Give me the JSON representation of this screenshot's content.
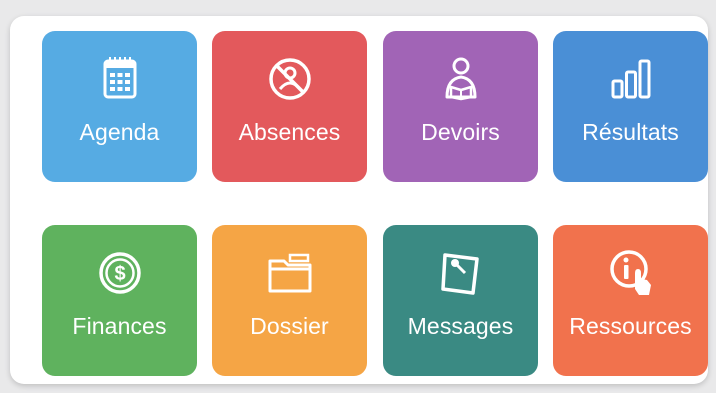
{
  "tiles": [
    {
      "label": "Agenda",
      "icon": "calendar-icon",
      "color": "#56abe3"
    },
    {
      "label": "Absences",
      "icon": "no-person-icon",
      "color": "#e3595c"
    },
    {
      "label": "Devoirs",
      "icon": "student-reading-icon",
      "color": "#a164b6"
    },
    {
      "label": "Résultats",
      "icon": "bar-chart-icon",
      "color": "#4a8fd6"
    },
    {
      "label": "Finances",
      "icon": "dollar-coin-icon",
      "color": "#5fb25e"
    },
    {
      "label": "Dossier",
      "icon": "folder-icon",
      "color": "#f5a545"
    },
    {
      "label": "Messages",
      "icon": "pinned-note-icon",
      "color": "#3a8a83"
    },
    {
      "label": "Ressources",
      "icon": "info-touch-icon",
      "color": "#f1724d"
    }
  ]
}
